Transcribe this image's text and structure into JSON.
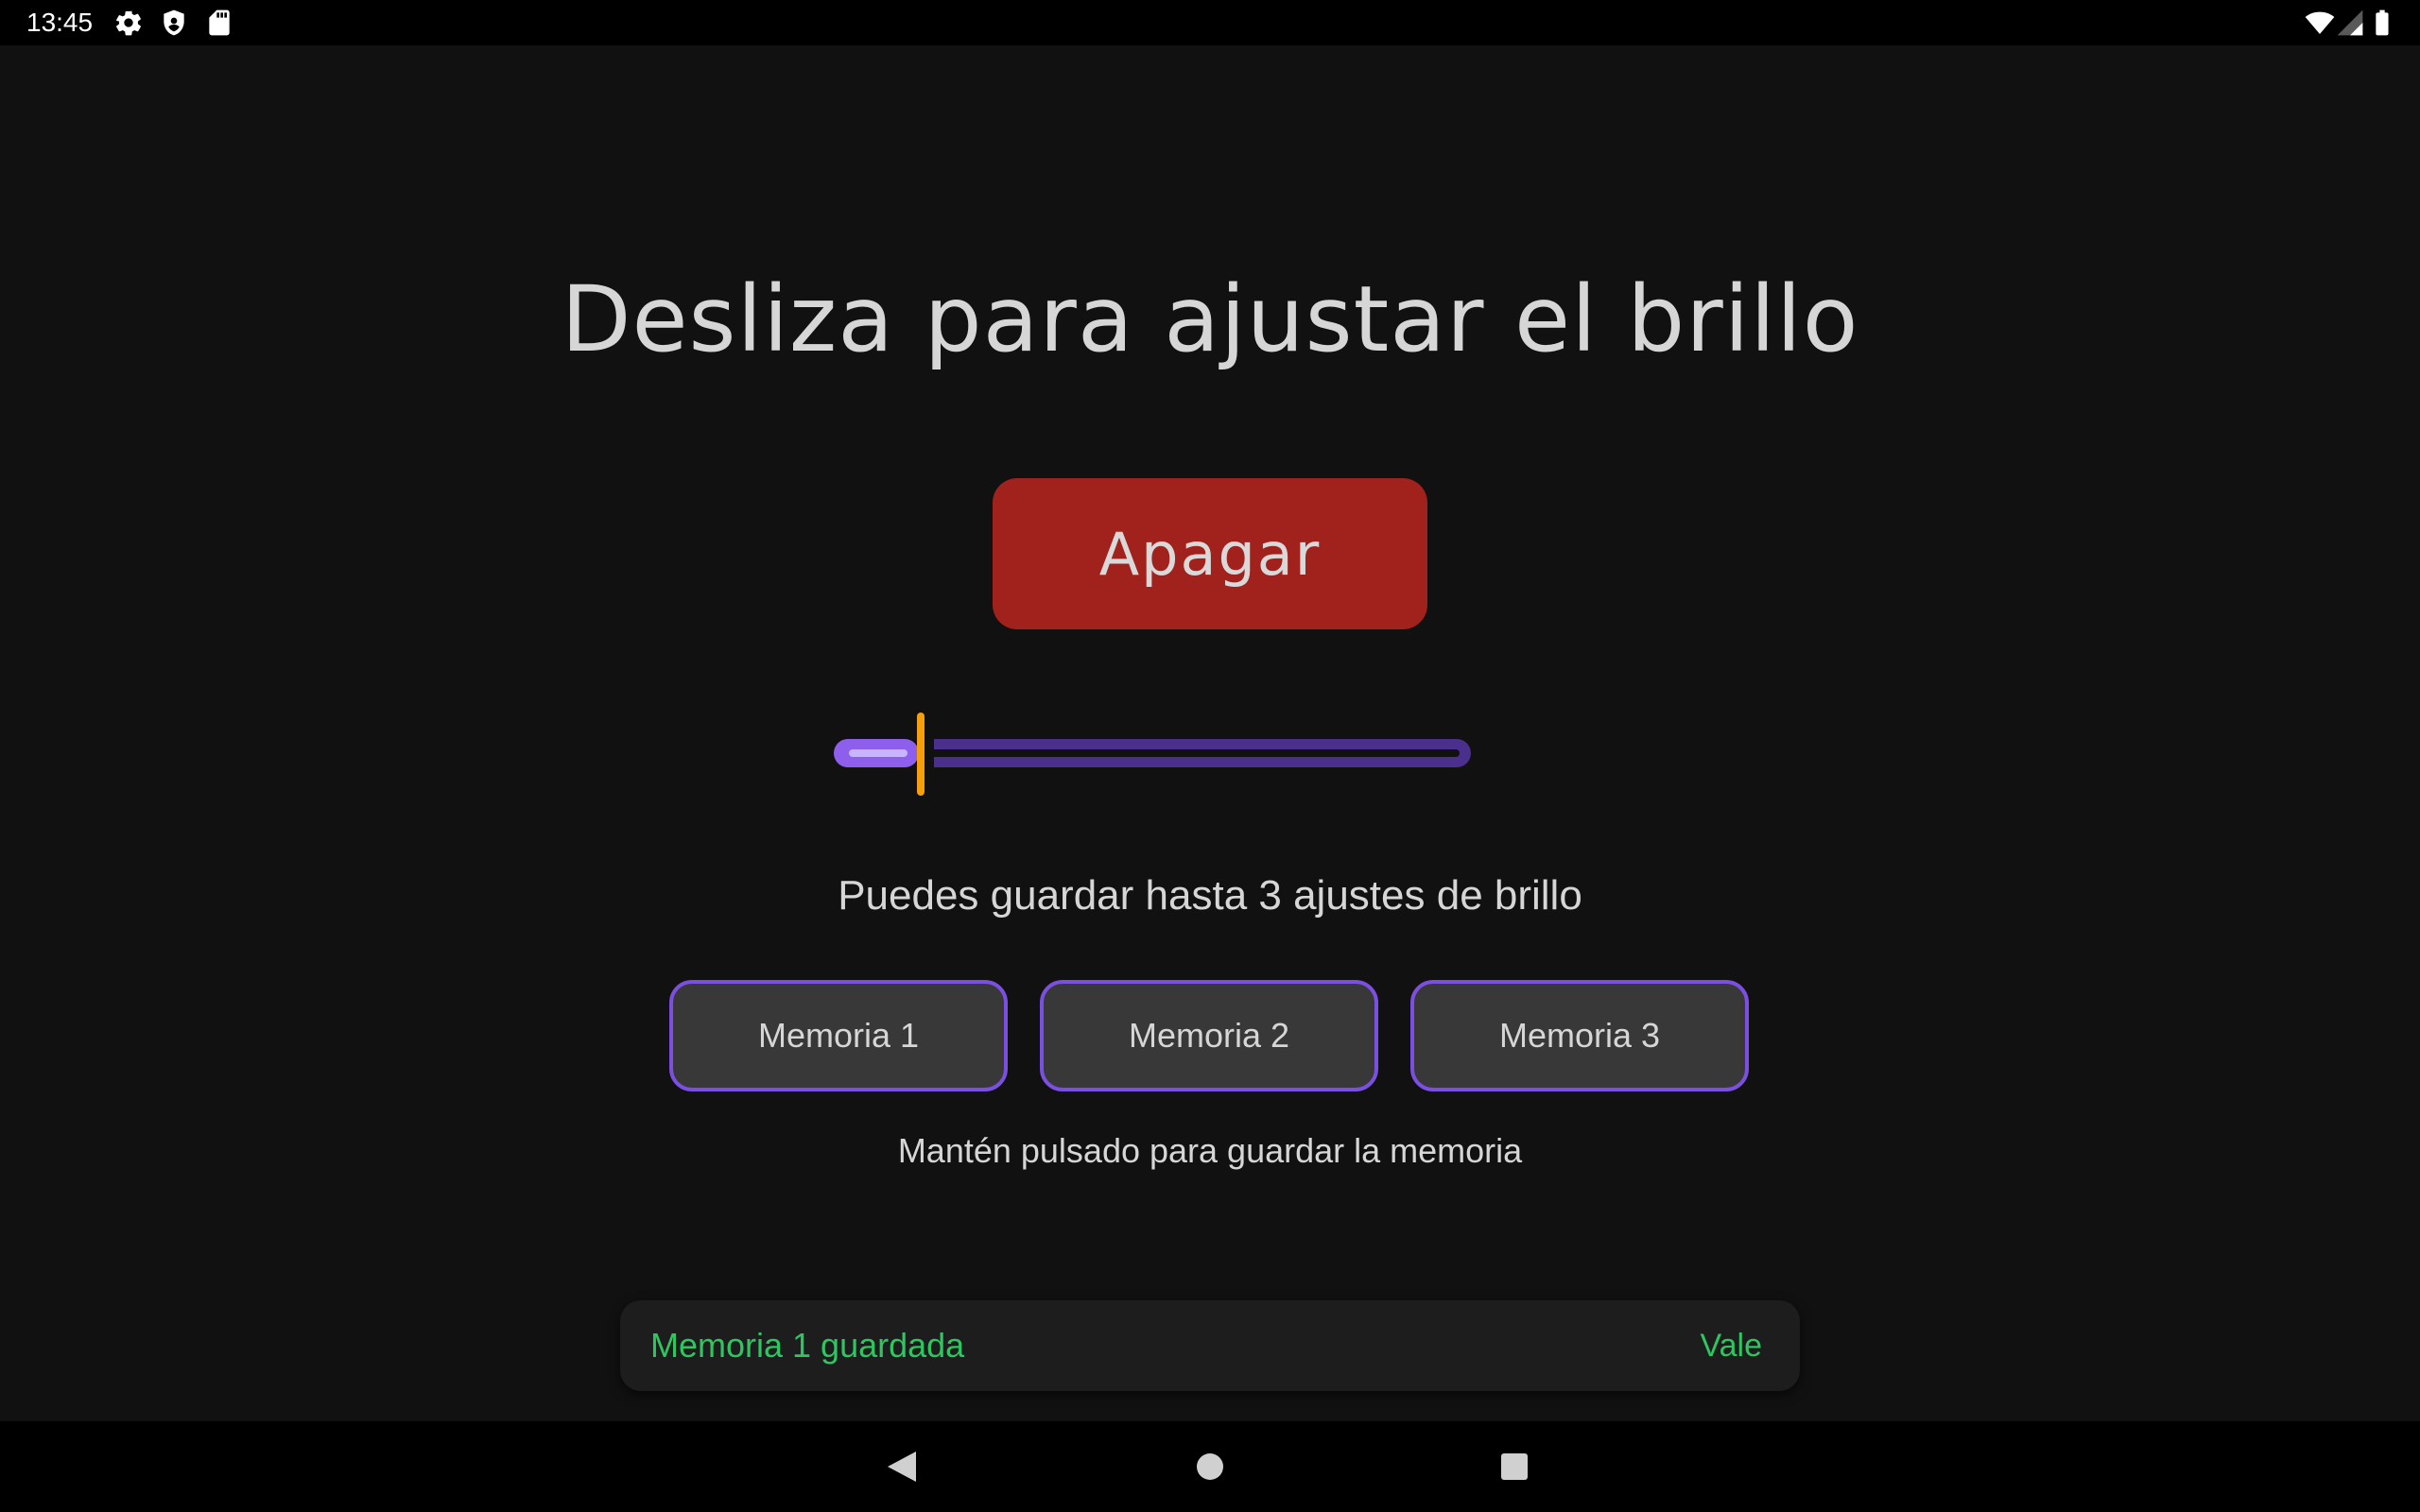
{
  "status_bar": {
    "time": "13:45",
    "left_icons": [
      "gear-icon",
      "shield-icon",
      "sd-card-icon"
    ],
    "right_icons": [
      "wifi-icon",
      "cell-signal-icon",
      "battery-icon"
    ]
  },
  "main": {
    "title": "Desliza para ajustar el brillo",
    "off_button_label": "Apagar",
    "brightness_slider": {
      "value": 0.1,
      "active_color": "#8e5fec",
      "inactive_color": "#4a2f8c",
      "thumb_color": "#f5a00a"
    },
    "info_text": "Puedes guardar hasta 3 ajustes de brillo",
    "memory_buttons": [
      {
        "label": "Memoria 1"
      },
      {
        "label": "Memoria 2"
      },
      {
        "label": "Memoria 3"
      }
    ],
    "hint_text": "Mantén pulsado para guardar la memoria"
  },
  "snackbar": {
    "message": "Memoria 1 guardada",
    "action_label": "Vale",
    "text_color": "#2fc561"
  },
  "nav_bar": {
    "buttons": [
      "back-icon",
      "home-icon",
      "recents-icon"
    ]
  },
  "colors": {
    "background": "#111111",
    "off_button": "#a1211c",
    "memory_border": "#7b4fe0",
    "memory_bg": "#383838"
  }
}
